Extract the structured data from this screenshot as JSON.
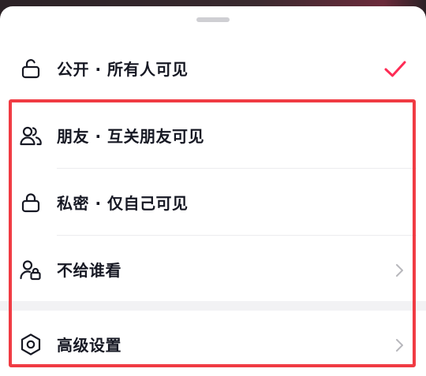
{
  "sheet": {
    "options": [
      {
        "label": "公开 · 所有人可见",
        "icon": "unlock-icon",
        "selected": true
      },
      {
        "label": "朋友 · 互关朋友可见",
        "icon": "friends-icon"
      },
      {
        "label": "私密 · 仅自己可见",
        "icon": "lock-icon"
      },
      {
        "label": "不给谁看",
        "icon": "user-lock-icon",
        "trailing": "chevron-right-icon"
      },
      {
        "label": "高级设置",
        "icon": "hexagon-settings-icon",
        "trailing": "chevron-right-icon"
      }
    ]
  },
  "colors": {
    "accent": "#FE2C55",
    "highlight": "#F03B43",
    "text": "#161823",
    "chevron": "#B7B7BC"
  }
}
